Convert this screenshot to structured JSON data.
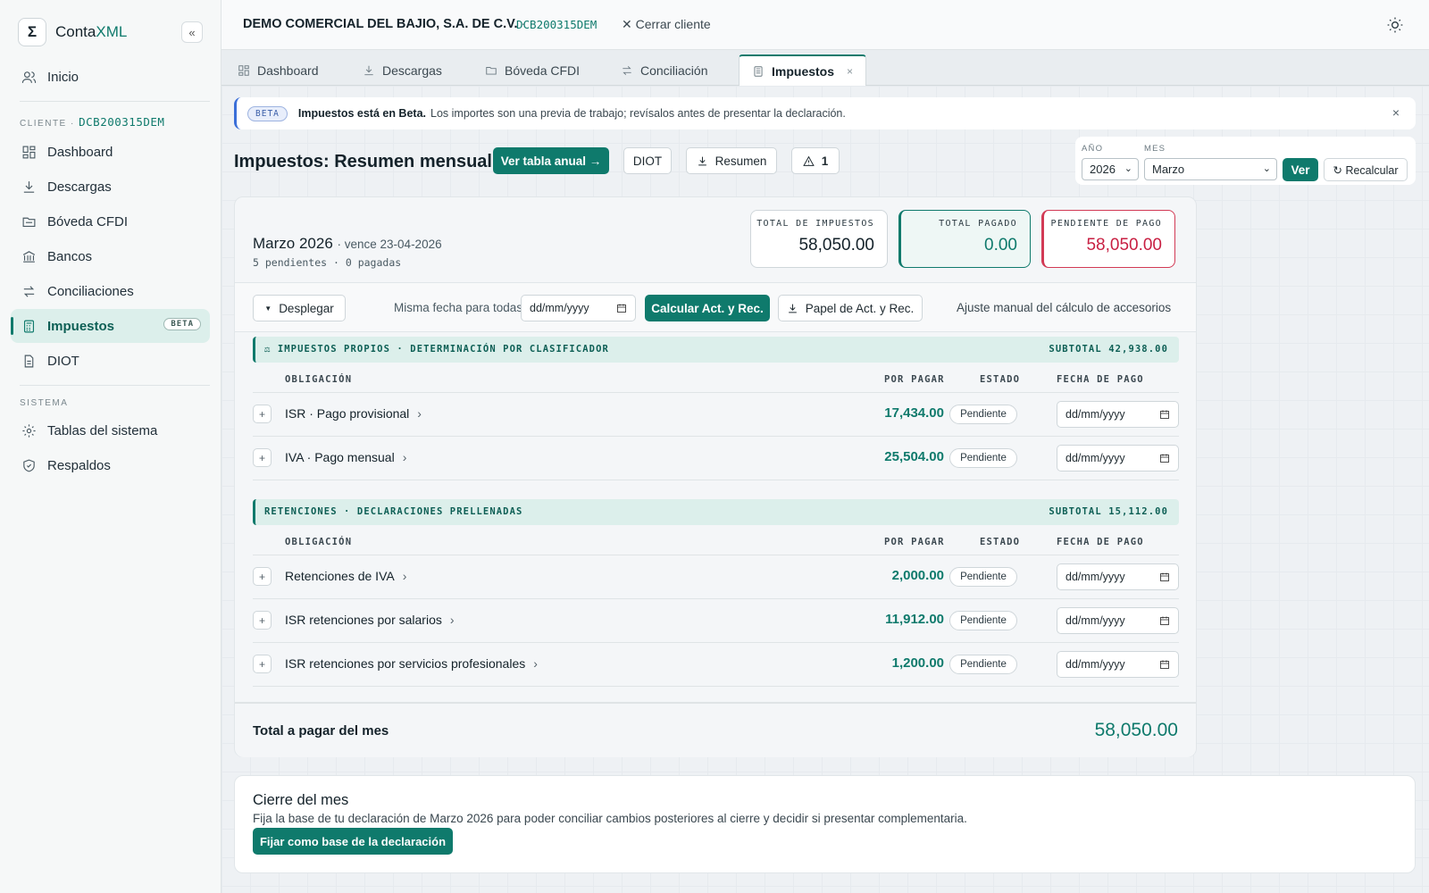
{
  "app": {
    "logo_glyph": "Σ",
    "name_part1": "Conta",
    "name_part2": "XML",
    "collapse_glyph": "«"
  },
  "sidebar": {
    "inicio": "Inicio",
    "client_label": "CLIENTE ·",
    "client_rfc": "DCB200315DEM",
    "items": [
      "Dashboard",
      "Descargas",
      "Bóveda CFDI",
      "Bancos",
      "Conciliaciones",
      "Impuestos",
      "DIOT"
    ],
    "beta_badge": "BETA",
    "system_label": "SISTEMA",
    "system_items": [
      "Tablas del sistema",
      "Respaldos"
    ]
  },
  "topbar": {
    "company": "DEMO COMERCIAL DEL BAJIO, S.A. DE C.V.",
    "separator": "·",
    "rfc": "DCB200315DEM",
    "close_client": "Cerrar cliente"
  },
  "tabs": [
    "Dashboard",
    "Descargas",
    "Bóveda CFDI",
    "Conciliación",
    "Impuestos"
  ],
  "tab_close": "×",
  "banner": {
    "badge": "BETA",
    "bold": "Impuestos está en Beta.",
    "text": "Los importes son una previa de trabajo; revísalos antes de presentar la declaración.",
    "close": "×"
  },
  "header": {
    "title": "Impuestos: Resumen mensual",
    "btn_annual": "Ver tabla anual →",
    "btn_diot": "DIOT",
    "btn_resumen": "Resumen",
    "btn_warn_count": "1"
  },
  "period": {
    "year_label": "AÑO",
    "month_label": "MES",
    "year": "2026",
    "month": "Marzo",
    "btn_ver": "Ver",
    "btn_recalc": "↻ Recalcular"
  },
  "summary": {
    "month": "Marzo 2026",
    "due": "· vence 23-04-2026",
    "sub": "5 pendientes · 0 pagadas",
    "kpi_total_label": "TOTAL DE IMPUESTOS",
    "kpi_total": "58,050.00",
    "kpi_paid_label": "TOTAL PAGADO",
    "kpi_paid": "0.00",
    "kpi_pending_label": "PENDIENTE DE PAGO",
    "kpi_pending": "58,050.00"
  },
  "toolbar": {
    "btn_expand": "Desplegar",
    "same_date": "Misma fecha para todas",
    "date_placeholder": "dd/mm/yyyy",
    "btn_calc": "Calcular Act. y Rec.",
    "btn_paper": "Papel de Act. y Rec.",
    "manual": "Ajuste manual del cálculo de accesorios"
  },
  "columns": {
    "obligation": "OBLIGACIÓN",
    "to_pay": "POR PAGAR",
    "status": "ESTADO",
    "pay_date": "FECHA DE PAGO"
  },
  "section1": {
    "title": "IMPUESTOS PROPIOS · DETERMINACIÓN POR CLASIFICADOR",
    "subtotal": "SUBTOTAL 42,938.00",
    "rows": [
      {
        "name": "ISR · Pago provisional",
        "amount": "17,434.00",
        "status": "Pendiente",
        "date": "dd/mm/yyyy"
      },
      {
        "name": "IVA · Pago mensual",
        "amount": "25,504.00",
        "status": "Pendiente",
        "date": "dd/mm/yyyy"
      }
    ]
  },
  "section2": {
    "title": "RETENCIONES · DECLARACIONES PRELLENADAS",
    "subtotal": "SUBTOTAL 15,112.00",
    "rows": [
      {
        "name": "Retenciones de IVA",
        "amount": "2,000.00",
        "status": "Pendiente",
        "date": "dd/mm/yyyy"
      },
      {
        "name": "ISR retenciones por salarios",
        "amount": "11,912.00",
        "status": "Pendiente",
        "date": "dd/mm/yyyy"
      },
      {
        "name": "ISR retenciones por servicios profesionales",
        "amount": "1,200.00",
        "status": "Pendiente",
        "date": "dd/mm/yyyy"
      }
    ]
  },
  "row_plus": "+",
  "row_chev": "›",
  "total": {
    "label": "Total a pagar del mes",
    "value": "58,050.00"
  },
  "close_month": {
    "title": "Cierre del mes",
    "desc": "Fija la base de tu declaración de Marzo 2026 para poder conciliar cambios posteriores al cierre y decidir si presentar complementaria.",
    "button": "Fijar como base de la declaración"
  },
  "colors": {
    "accent": "#0f7a6c",
    "danger": "#c81f42",
    "info": "#3b6fd8"
  }
}
